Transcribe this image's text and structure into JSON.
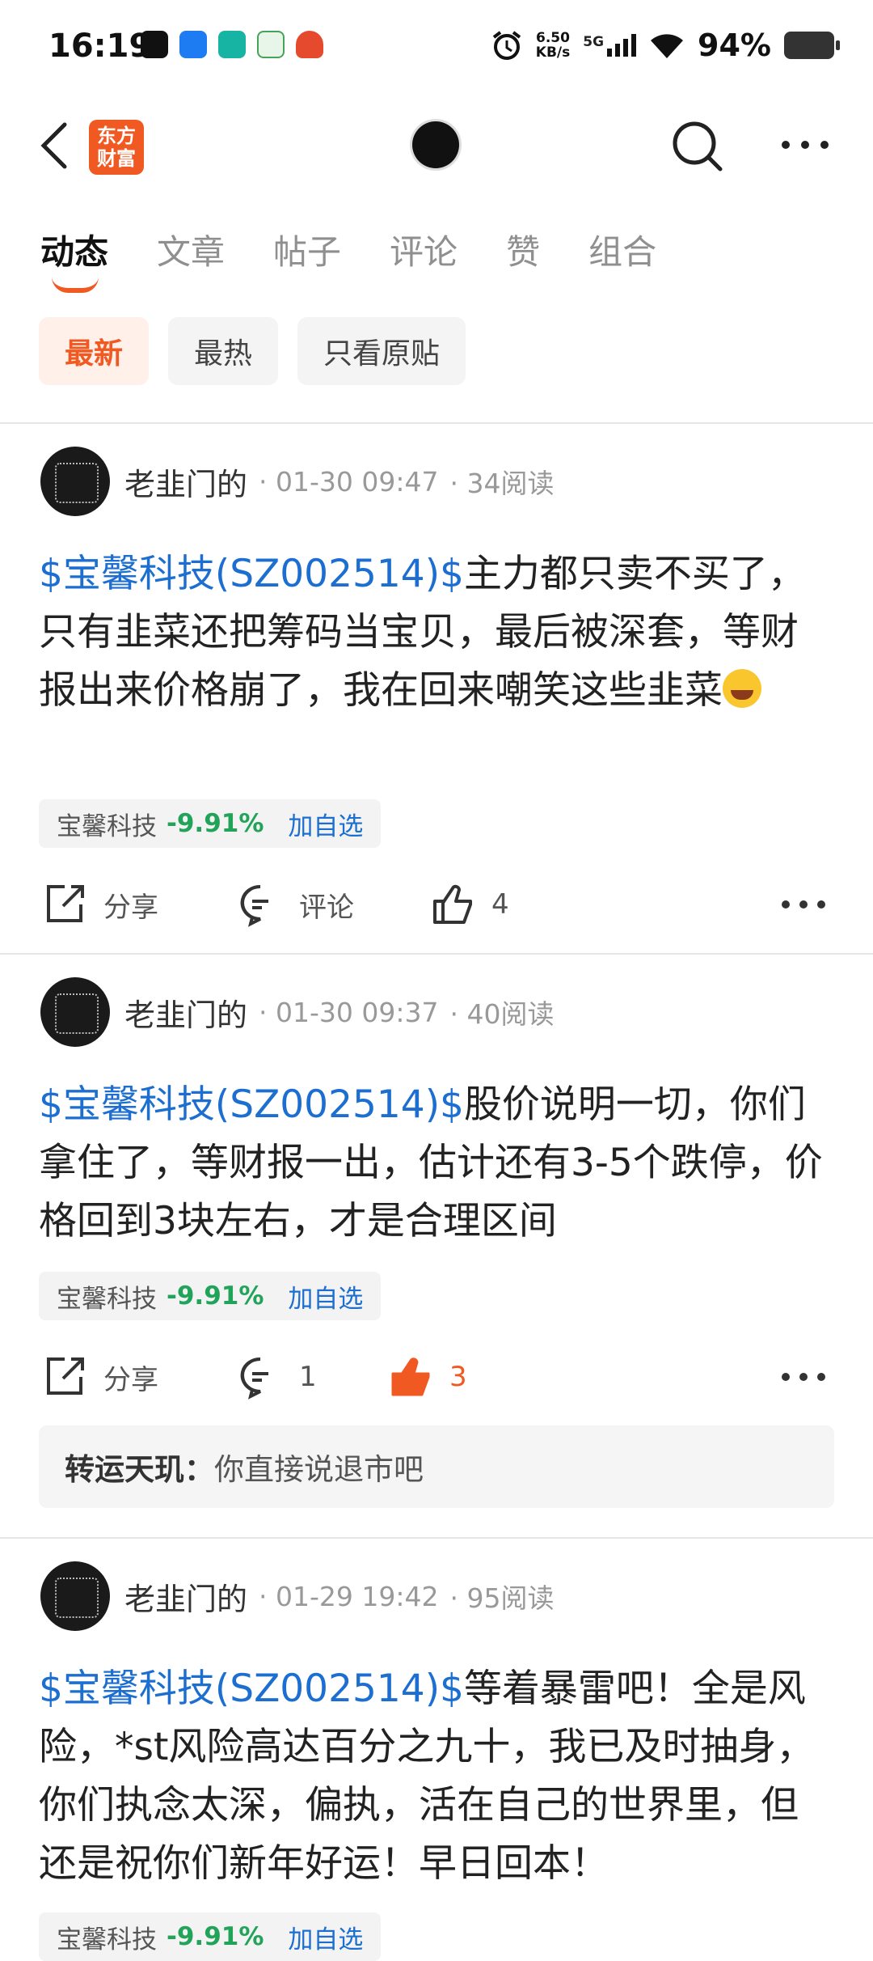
{
  "status_bar": {
    "time": "16:19",
    "speed_top": "6.50",
    "speed_bottom": "KB/s",
    "network": "5G",
    "battery": "94%"
  },
  "header": {
    "brand_line1": "东方",
    "brand_line2": "财富"
  },
  "tabs": [
    {
      "label": "动态"
    },
    {
      "label": "文章"
    },
    {
      "label": "帖子"
    },
    {
      "label": "评论"
    },
    {
      "label": "赞"
    },
    {
      "label": "组合"
    }
  ],
  "filters": [
    {
      "label": "最新"
    },
    {
      "label": "最热"
    },
    {
      "label": "只看原贴"
    }
  ],
  "posts": [
    {
      "author": "老韭门的",
      "time": "· 01-30 09:47",
      "reads": "· 34阅读",
      "stock": "$宝馨科技(SZ002514)$",
      "text": "主力都只卖不买了，只有韭菜还把筹码当宝贝，最后被深套，等财报出来价格崩了，我在回来嘲笑这些韭菜",
      "tag_name": "宝馨科技",
      "tag_pct": "-9.91%",
      "tag_add": "加自选",
      "share": "分享",
      "comment": "评论",
      "likes": "4"
    },
    {
      "author": "老韭门的",
      "time": "· 01-30 09:37",
      "reads": "· 40阅读",
      "stock": "$宝馨科技(SZ002514)$",
      "text": "股价说明一切，你们拿住了，等财报一出，估计还有3-5个跌停，价格回到3块左右，才是合理区间",
      "tag_name": "宝馨科技",
      "tag_pct": "-9.91%",
      "tag_add": "加自选",
      "share": "分享",
      "comment": "1",
      "likes": "3",
      "reply_name": "转运天玑：",
      "reply_text": "你直接说退市吧"
    },
    {
      "author": "老韭门的",
      "time": "· 01-29 19:42",
      "reads": "· 95阅读",
      "stock": "$宝馨科技(SZ002514)$",
      "text": "等着暴雷吧！全是风险，*st风险高达百分之九十，我已及时抽身，你们执念太深，偏执，活在自己的世界里，但还是祝你们新年好运！早日回本！",
      "tag_name": "宝馨科技",
      "tag_pct": "-9.91%",
      "tag_add": "加自选"
    }
  ],
  "colors": {
    "accent": "#f05a22",
    "link": "#1c6fd0",
    "down": "#22a35a"
  }
}
